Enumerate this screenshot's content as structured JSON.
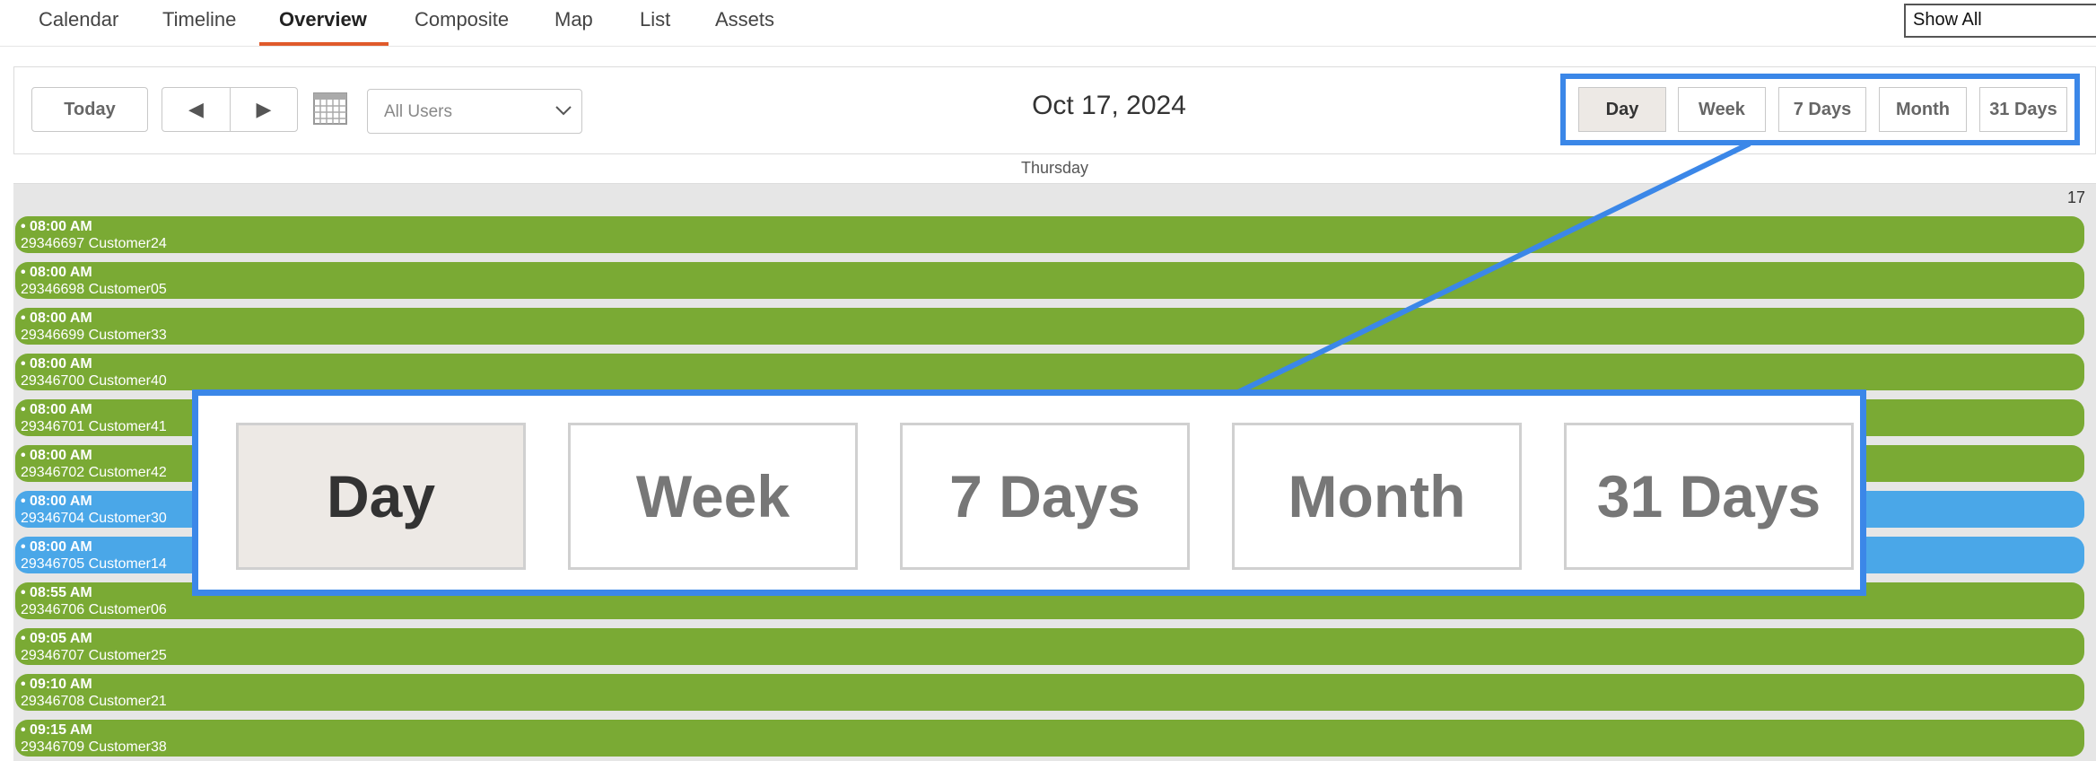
{
  "nav": {
    "tabs": [
      {
        "label": "Calendar"
      },
      {
        "label": "Timeline"
      },
      {
        "label": "Overview"
      },
      {
        "label": "Composite"
      },
      {
        "label": "Map"
      },
      {
        "label": "List"
      },
      {
        "label": "Assets"
      }
    ],
    "active_tab": "Overview",
    "filter_value": "Show All"
  },
  "toolbar": {
    "today_label": "Today",
    "prev_glyph": "◀",
    "next_glyph": "▶",
    "users_select": "All Users",
    "date_title": "Oct 17, 2024",
    "views": [
      "Day",
      "Week",
      "7 Days",
      "Month",
      "31 Days"
    ],
    "active_view": "Day"
  },
  "calendar": {
    "weekday": "Thursday",
    "day_number": "17",
    "events": [
      {
        "time": "• 08:00 AM",
        "name": "29346697 Customer24",
        "color": "green"
      },
      {
        "time": "• 08:00 AM",
        "name": "29346698 Customer05",
        "color": "green"
      },
      {
        "time": "• 08:00 AM",
        "name": "29346699 Customer33",
        "color": "green"
      },
      {
        "time": "• 08:00 AM",
        "name": "29346700 Customer40",
        "color": "green"
      },
      {
        "time": "• 08:00 AM",
        "name": "29346701 Customer41",
        "color": "green"
      },
      {
        "time": "• 08:00 AM",
        "name": "29346702 Customer42",
        "color": "green"
      },
      {
        "time": "• 08:00 AM",
        "name": "29346704 Customer30",
        "color": "blue"
      },
      {
        "time": "• 08:00 AM",
        "name": "29346705 Customer14",
        "color": "blue"
      },
      {
        "time": "• 08:55 AM",
        "name": "29346706 Customer06",
        "color": "green"
      },
      {
        "time": "• 09:05 AM",
        "name": "29346707 Customer25",
        "color": "green"
      },
      {
        "time": "• 09:10 AM",
        "name": "29346708 Customer21",
        "color": "green"
      },
      {
        "time": "• 09:15 AM",
        "name": "29346709 Customer38",
        "color": "green"
      }
    ]
  },
  "colors": {
    "accent": "#e05a2b",
    "event_green": "#7aaa34",
    "event_blue": "#4aa7e8",
    "callout": "#3b87e8"
  }
}
